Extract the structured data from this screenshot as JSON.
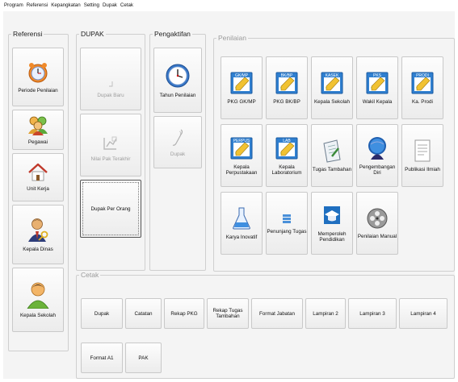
{
  "menu": [
    "Program",
    "Referensi",
    "Kepangkatan",
    "Setting",
    "Dupak",
    "Cetak"
  ],
  "groups": {
    "referensi": "Referensi",
    "dupak": "DUPAK",
    "pengaktifan": "Pengaktifan",
    "penilaian": "Penilaian",
    "cetak": "Cetak"
  },
  "referensi": [
    "Periode Penilaian",
    "Pegawai",
    "Unit Kerja",
    "Kepala Dinas",
    "Kepala Sekolah"
  ],
  "dupak": [
    "Dupak Baru",
    "Nilai Pak Terakhir",
    "Dupak Per Orang"
  ],
  "pengaktifan": [
    "Tahun Penilaian",
    "Dupak"
  ],
  "penilaian": [
    {
      "label": "PKG GK/MP",
      "tag": "GK/MP"
    },
    {
      "label": "PKG BK/BP",
      "tag": "BK/BP"
    },
    {
      "label": "Kepala Sekolah",
      "tag": "KASEK"
    },
    {
      "label": "Wakil Kepala",
      "tag": "PKS"
    },
    {
      "label": "Ka. Prodi",
      "tag": "PRODI"
    },
    {
      "label": "Kepala\nPerpustakaan",
      "tag": "PERPUS"
    },
    {
      "label": "Kepala\nLaboratorium",
      "tag": "LAB"
    },
    {
      "label": "Tugas Tambahan",
      "tag": ""
    },
    {
      "label": "Pengembangan\nDiri",
      "tag": ""
    },
    {
      "label": "Publikasi Ilmiah",
      "tag": ""
    },
    {
      "label": "Karya Inovatif",
      "tag": ""
    },
    {
      "label": "Penunjang Tugas",
      "tag": ""
    },
    {
      "label": "Memperoleh\nPendidikan",
      "tag": ""
    },
    {
      "label": "Penilaian Manual",
      "tag": ""
    }
  ],
  "cetak": [
    "Dupak",
    "Catatan",
    "Rekap PKG",
    "Rekap Tugas\nTambahan",
    "Format Jabatan",
    "Lampiran 2",
    "Lampiran 3",
    "Lampiran 4",
    "Format A1",
    "PAK"
  ],
  "colors": {
    "window_bg": "#f4f4f4",
    "button_face": "#ececec",
    "disabled_text": "#9d9d9d"
  }
}
